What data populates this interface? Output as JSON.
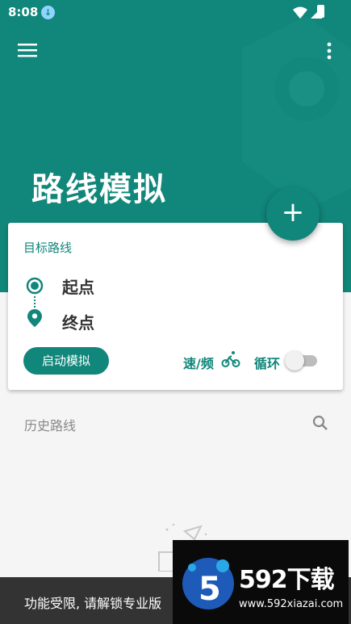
{
  "status_bar": {
    "time": "8:08",
    "download_icon": "download-icon",
    "icons": [
      "wifi-icon",
      "signal-icon",
      "battery-charging-icon"
    ]
  },
  "toolbar": {
    "menu_icon": "menu-icon",
    "more_icon": "more-vert-icon"
  },
  "header": {
    "title": "路线模拟",
    "accent_color": "#11867a"
  },
  "fab": {
    "label": "+",
    "icon": "add-icon"
  },
  "route_card": {
    "title": "目标路线",
    "start_label": "起点",
    "end_label": "终点",
    "simulate_button": "启动模拟",
    "speed_label": "速/频",
    "speed_icon": "bicycle-icon",
    "loop_label": "循环",
    "loop_enabled": false
  },
  "history": {
    "title": "历史路线",
    "search_icon": "search-icon"
  },
  "snackbar": {
    "message": "功能受限, 请解锁专业版"
  },
  "watermark": {
    "brand": "592下载",
    "url": "www.592xiazai.com"
  }
}
